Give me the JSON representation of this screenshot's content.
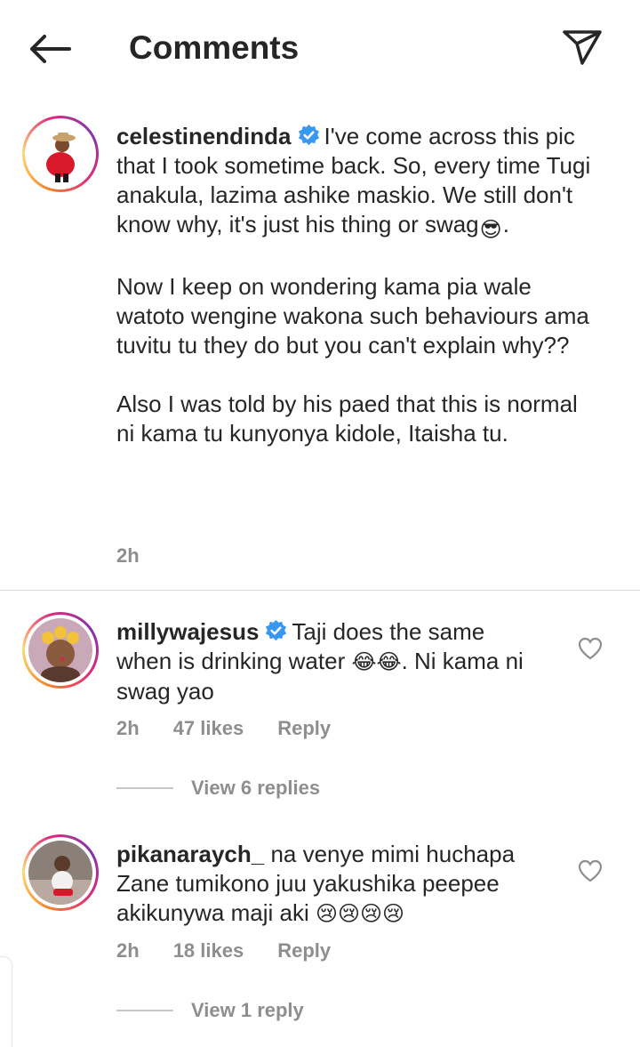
{
  "header": {
    "title": "Comments",
    "back_icon": "arrow-left-icon",
    "share_icon": "send-icon"
  },
  "caption": {
    "username": "celestinendinda",
    "verified": true,
    "text_part1": "I've come across this pic that I took sometime back. So, every time Tugi anakula, lazima ashike maskio. We still don't know why, it's just his thing or swag",
    "emoji1": "😎",
    "text_part2": ".\n\nNow I keep on wondering kama pia wale watoto wengine wakona such behaviours ama tuvitu tu they do but you can't explain why??\n\nAlso I was told by his paed that this is normal ni kama tu kunyonya kidole, Itaisha tu.",
    "time": "2h"
  },
  "comments": [
    {
      "username": "millywajesus",
      "verified": true,
      "text_part1": "Taji does the same when is drinking water ",
      "emojis": "😂😂",
      "text_part2": ". Ni kama ni swag yao",
      "time": "2h",
      "likes": "47 likes",
      "reply_label": "Reply",
      "view_replies": "View 6 replies"
    },
    {
      "username": "pikanaraych_",
      "verified": false,
      "text_part1": "na venye mimi huchapa Zane tumikono juu yakushika peepee akikunywa maji aki ",
      "emojis": "😢😢😢😢",
      "text_part2": "",
      "time": "2h",
      "likes": "18 likes",
      "reply_label": "Reply",
      "view_replies": "View 1 reply"
    }
  ],
  "colors": {
    "text": "#262626",
    "muted": "#8e8e8e",
    "verified": "#3897f0",
    "divider": "#dbdbdb"
  }
}
